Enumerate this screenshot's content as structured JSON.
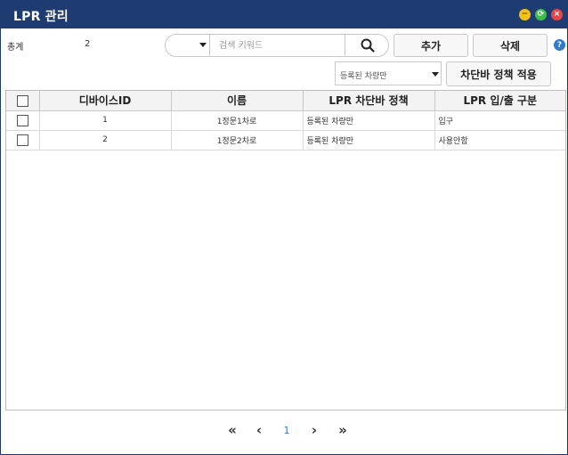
{
  "window": {
    "title": "LPR 관리",
    "controls": {
      "minimize": "−",
      "maximize": "⟳",
      "close": "×"
    }
  },
  "summary": {
    "label": "총계",
    "count": "2"
  },
  "search": {
    "placeholder": "검색 키워드",
    "value": "",
    "scope_value": ""
  },
  "toolbar": {
    "add_label": "추가",
    "delete_label": "삭제",
    "help_label": "?"
  },
  "policy": {
    "selected": "등록된 차량만",
    "apply_label": "차단바 정책 적용"
  },
  "table": {
    "columns": [
      "디바이스ID",
      "이름",
      "LPR 차단바 정책",
      "LPR 입/출 구분"
    ],
    "rows": [
      {
        "device_id": "1",
        "name": "1정문1차로",
        "policy": "등록된 차량만",
        "direction": "입구"
      },
      {
        "device_id": "2",
        "name": "1정문2차로",
        "policy": "등록된 차량만",
        "direction": "사용안함"
      }
    ]
  },
  "pagination": {
    "first": "«",
    "prev": "‹",
    "current": "1",
    "next": "›",
    "last": "»"
  },
  "colors": {
    "titlebar": "#1f3c72",
    "accent": "#2f79d0"
  }
}
